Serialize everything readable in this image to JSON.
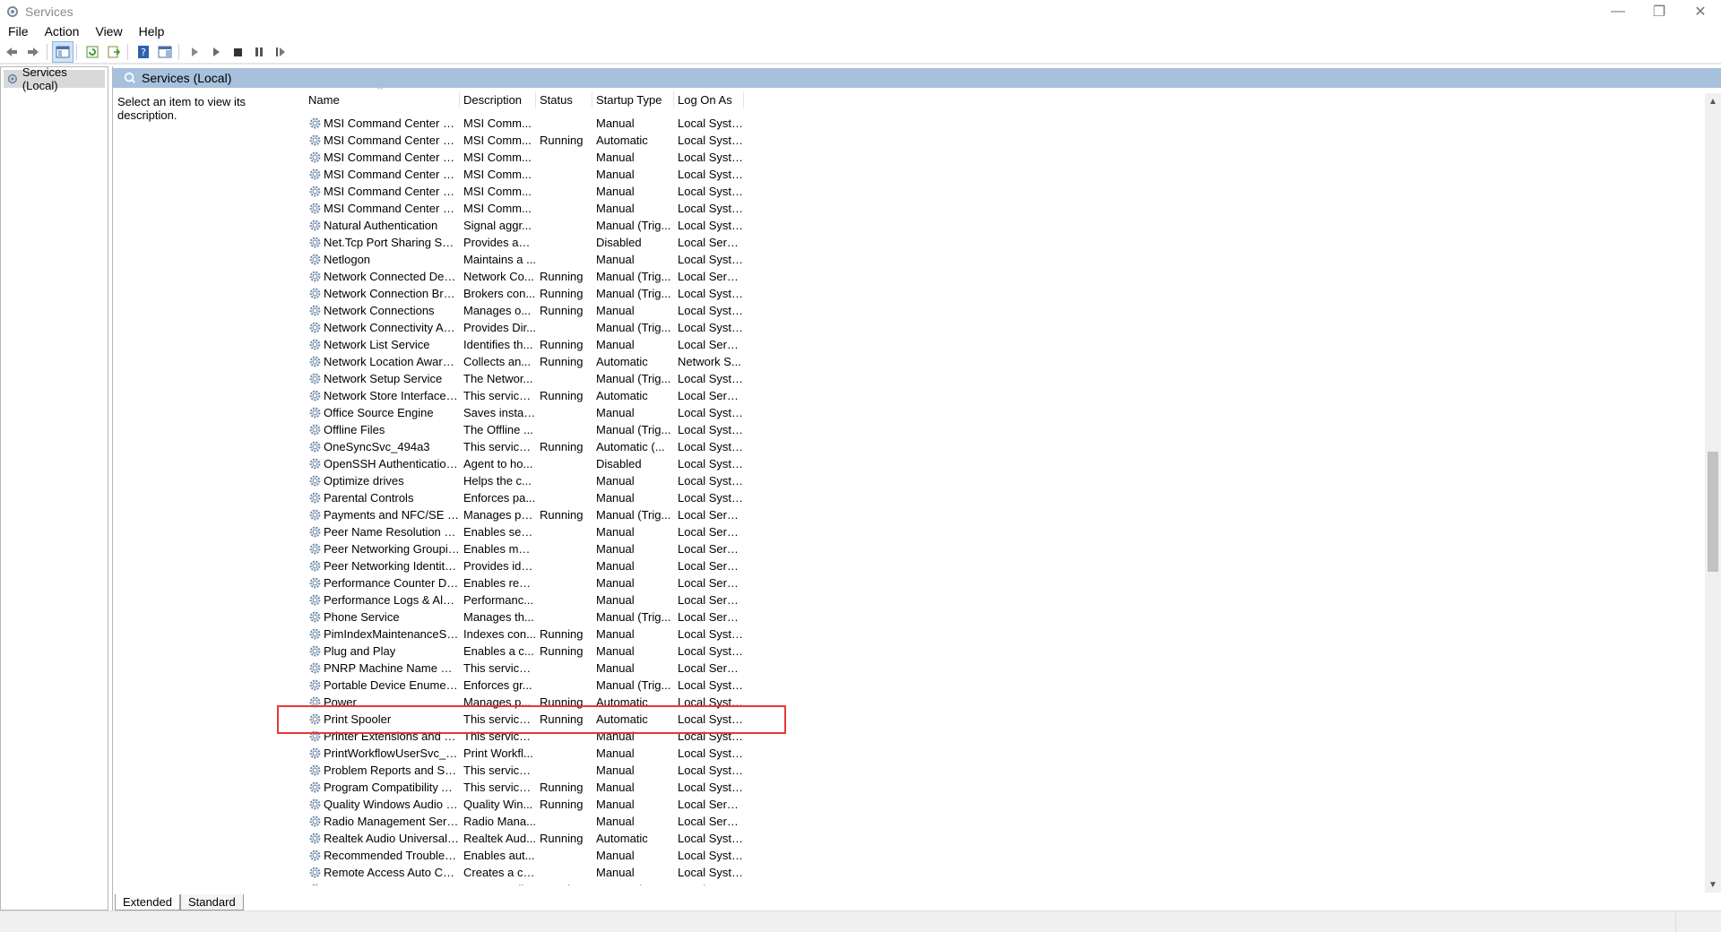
{
  "window": {
    "title": "Services",
    "minimize_glyph": "—",
    "restore_glyph": "❐",
    "close_glyph": "✕"
  },
  "menu": [
    "File",
    "Action",
    "View",
    "Help"
  ],
  "toolbar_icons": [
    "back-icon",
    "forward-icon",
    "show-console-tree-icon",
    "refresh-icon",
    "export-list-icon",
    "help-icon",
    "properties-icon",
    "start-service-icon",
    "start-service-alt-icon",
    "stop-service-icon",
    "pause-service-icon",
    "resume-service-icon"
  ],
  "tree": {
    "root_label": "Services (Local)"
  },
  "content": {
    "header_title": "Services (Local)",
    "description_prompt": "Select an item to view its description.",
    "sort_glyph": "^"
  },
  "columns": {
    "name": "Name",
    "description": "Description",
    "status": "Status",
    "startup": "Startup Type",
    "logon": "Log On As"
  },
  "services": [
    {
      "name": "MSI Command Center Com...",
      "desc": "MSI Comm...",
      "status": "",
      "start": "Manual",
      "logon": "Local Syste..."
    },
    {
      "name": "MSI Command Center Cont...",
      "desc": "MSI Comm...",
      "status": "Running",
      "start": "Automatic",
      "logon": "Local Syste..."
    },
    {
      "name": "MSI Command Center CPU ...",
      "desc": "MSI Comm...",
      "status": "",
      "start": "Manual",
      "logon": "Local Syste..."
    },
    {
      "name": "MSI Command Center DDR ...",
      "desc": "MSI Comm...",
      "status": "",
      "start": "Manual",
      "logon": "Local Syste..."
    },
    {
      "name": "MSI Command Center SMB...",
      "desc": "MSI Comm...",
      "status": "",
      "start": "Manual",
      "logon": "Local Syste..."
    },
    {
      "name": "MSI Command Center Supe...",
      "desc": "MSI Comm...",
      "status": "",
      "start": "Manual",
      "logon": "Local Syste..."
    },
    {
      "name": "Natural Authentication",
      "desc": "Signal aggr...",
      "status": "",
      "start": "Manual (Trig...",
      "logon": "Local Syste..."
    },
    {
      "name": "Net.Tcp Port Sharing Service",
      "desc": "Provides abi...",
      "status": "",
      "start": "Disabled",
      "logon": "Local Service"
    },
    {
      "name": "Netlogon",
      "desc": "Maintains a ...",
      "status": "",
      "start": "Manual",
      "logon": "Local Syste..."
    },
    {
      "name": "Network Connected Device...",
      "desc": "Network Co...",
      "status": "Running",
      "start": "Manual (Trig...",
      "logon": "Local Service"
    },
    {
      "name": "Network Connection Broker",
      "desc": "Brokers con...",
      "status": "Running",
      "start": "Manual (Trig...",
      "logon": "Local Syste..."
    },
    {
      "name": "Network Connections",
      "desc": "Manages o...",
      "status": "Running",
      "start": "Manual",
      "logon": "Local Syste..."
    },
    {
      "name": "Network Connectivity Assis...",
      "desc": "Provides Dir...",
      "status": "",
      "start": "Manual (Trig...",
      "logon": "Local Syste..."
    },
    {
      "name": "Network List Service",
      "desc": "Identifies th...",
      "status": "Running",
      "start": "Manual",
      "logon": "Local Service"
    },
    {
      "name": "Network Location Awareness",
      "desc": "Collects an...",
      "status": "Running",
      "start": "Automatic",
      "logon": "Network S..."
    },
    {
      "name": "Network Setup Service",
      "desc": "The Networ...",
      "status": "",
      "start": "Manual (Trig...",
      "logon": "Local Syste..."
    },
    {
      "name": "Network Store Interface Ser...",
      "desc": "This service ...",
      "status": "Running",
      "start": "Automatic",
      "logon": "Local Service"
    },
    {
      "name": "Office  Source Engine",
      "desc": "Saves install...",
      "status": "",
      "start": "Manual",
      "logon": "Local Syste..."
    },
    {
      "name": "Offline Files",
      "desc": "The Offline ...",
      "status": "",
      "start": "Manual (Trig...",
      "logon": "Local Syste..."
    },
    {
      "name": "OneSyncSvc_494a3",
      "desc": "This service ...",
      "status": "Running",
      "start": "Automatic (...",
      "logon": "Local Syste..."
    },
    {
      "name": "OpenSSH Authentication A...",
      "desc": "Agent to ho...",
      "status": "",
      "start": "Disabled",
      "logon": "Local Syste..."
    },
    {
      "name": "Optimize drives",
      "desc": "Helps the c...",
      "status": "",
      "start": "Manual",
      "logon": "Local Syste..."
    },
    {
      "name": "Parental Controls",
      "desc": "Enforces pa...",
      "status": "",
      "start": "Manual",
      "logon": "Local Syste..."
    },
    {
      "name": "Payments and NFC/SE Man...",
      "desc": "Manages pa...",
      "status": "Running",
      "start": "Manual (Trig...",
      "logon": "Local Service"
    },
    {
      "name": "Peer Name Resolution Prot...",
      "desc": "Enables serv...",
      "status": "",
      "start": "Manual",
      "logon": "Local Service"
    },
    {
      "name": "Peer Networking Grouping",
      "desc": "Enables mul...",
      "status": "",
      "start": "Manual",
      "logon": "Local Service"
    },
    {
      "name": "Peer Networking Identity M...",
      "desc": "Provides ide...",
      "status": "",
      "start": "Manual",
      "logon": "Local Service"
    },
    {
      "name": "Performance Counter DLL ...",
      "desc": "Enables rem...",
      "status": "",
      "start": "Manual",
      "logon": "Local Service"
    },
    {
      "name": "Performance Logs & Alerts",
      "desc": "Performanc...",
      "status": "",
      "start": "Manual",
      "logon": "Local Service"
    },
    {
      "name": "Phone Service",
      "desc": "Manages th...",
      "status": "",
      "start": "Manual (Trig...",
      "logon": "Local Service"
    },
    {
      "name": "PimIndexMaintenanceSvc_...",
      "desc": "Indexes con...",
      "status": "Running",
      "start": "Manual",
      "logon": "Local Syste..."
    },
    {
      "name": "Plug and Play",
      "desc": "Enables a c...",
      "status": "Running",
      "start": "Manual",
      "logon": "Local Syste..."
    },
    {
      "name": "PNRP Machine Name Publi...",
      "desc": "This service ...",
      "status": "",
      "start": "Manual",
      "logon": "Local Service"
    },
    {
      "name": "Portable Device Enumerator...",
      "desc": "Enforces gr...",
      "status": "",
      "start": "Manual (Trig...",
      "logon": "Local Syste..."
    },
    {
      "name": "Power",
      "desc": "Manages p...",
      "status": "Running",
      "start": "Automatic",
      "logon": "Local Syste..."
    },
    {
      "name": "Print Spooler",
      "desc": "This service ...",
      "status": "Running",
      "start": "Automatic",
      "logon": "Local Syste..."
    },
    {
      "name": "Printer Extensions and Notif...",
      "desc": "This service ...",
      "status": "",
      "start": "Manual",
      "logon": "Local Syste..."
    },
    {
      "name": "PrintWorkflowUserSvc_494a3",
      "desc": "Print Workfl...",
      "status": "",
      "start": "Manual",
      "logon": "Local Syste..."
    },
    {
      "name": "Problem Reports and Soluti...",
      "desc": "This service ...",
      "status": "",
      "start": "Manual",
      "logon": "Local Syste..."
    },
    {
      "name": "Program Compatibility Assi...",
      "desc": "This service ...",
      "status": "Running",
      "start": "Manual",
      "logon": "Local Syste..."
    },
    {
      "name": "Quality Windows Audio Vid...",
      "desc": "Quality Win...",
      "status": "Running",
      "start": "Manual",
      "logon": "Local Service"
    },
    {
      "name": "Radio Management Service",
      "desc": "Radio Mana...",
      "status": "",
      "start": "Manual",
      "logon": "Local Service"
    },
    {
      "name": "Realtek Audio Universal Ser...",
      "desc": "Realtek Aud...",
      "status": "Running",
      "start": "Automatic",
      "logon": "Local Syste..."
    },
    {
      "name": "Recommended Troublesho...",
      "desc": "Enables aut...",
      "status": "",
      "start": "Manual",
      "logon": "Local Syste..."
    },
    {
      "name": "Remote Access Auto Conne...",
      "desc": "Creates a co...",
      "status": "",
      "start": "Manual",
      "logon": "Local Syste..."
    },
    {
      "name": "Remote Access Connection...",
      "desc": "Manages di...",
      "status": "Running",
      "start": "Automatic",
      "logon": "Local Syste..."
    }
  ],
  "tabs": [
    "Extended",
    "Standard"
  ],
  "colors": {
    "header_bar": "#a7c1dc",
    "highlight_box": "#e53935",
    "tree_selected": "#d9d9d9"
  }
}
